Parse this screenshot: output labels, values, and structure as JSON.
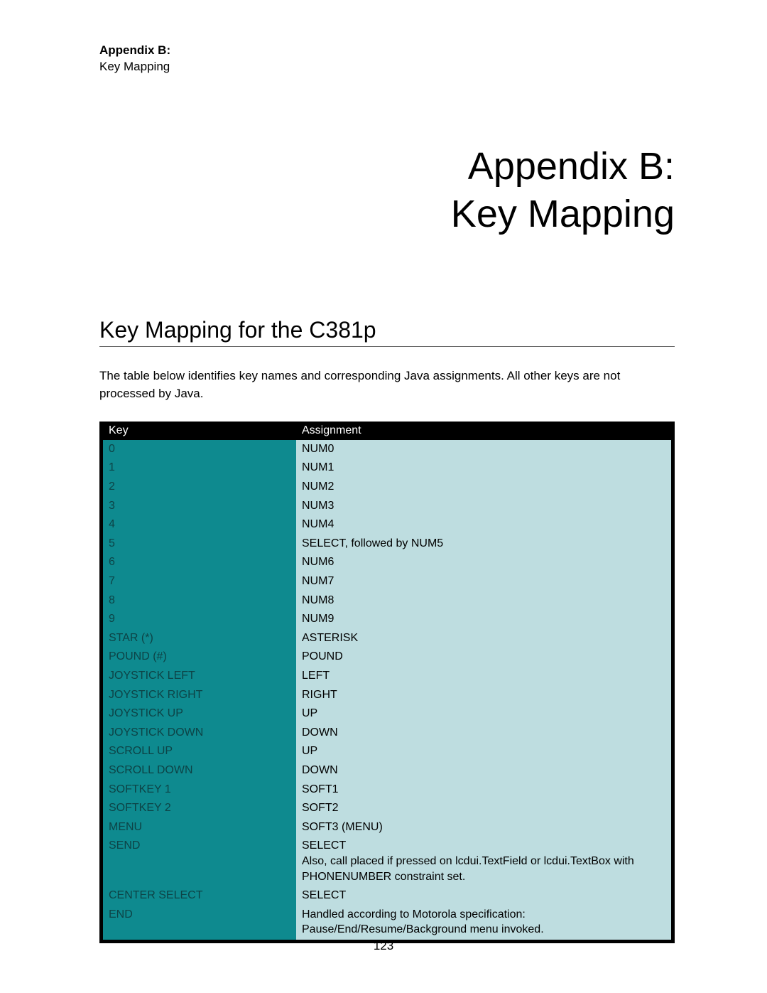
{
  "header": {
    "line1": "Appendix B:",
    "line2": "Key Mapping"
  },
  "title": {
    "line1": "Appendix B:",
    "line2": "Key Mapping"
  },
  "section_title": "Key Mapping for the C381p",
  "intro": "The table below identifies key names and corresponding Java assignments. All other keys are not processed by Java.",
  "table": {
    "headers": {
      "col1": "Key",
      "col2": "Assignment"
    },
    "rows": [
      {
        "key": "0",
        "assignment": "NUM0"
      },
      {
        "key": "1",
        "assignment": "NUM1"
      },
      {
        "key": "2",
        "assignment": "NUM2"
      },
      {
        "key": "3",
        "assignment": "NUM3"
      },
      {
        "key": "4",
        "assignment": "NUM4"
      },
      {
        "key": "5",
        "assignment": "SELECT, followed by NUM5"
      },
      {
        "key": "6",
        "assignment": "NUM6"
      },
      {
        "key": "7",
        "assignment": "NUM7"
      },
      {
        "key": "8",
        "assignment": "NUM8"
      },
      {
        "key": "9",
        "assignment": "NUM9"
      },
      {
        "key": "STAR (*)",
        "assignment": "ASTERISK"
      },
      {
        "key": "POUND (#)",
        "assignment": "POUND"
      },
      {
        "key": "JOYSTICK LEFT",
        "assignment": "LEFT"
      },
      {
        "key": "JOYSTICK RIGHT",
        "assignment": "RIGHT"
      },
      {
        "key": "JOYSTICK UP",
        "assignment": "UP"
      },
      {
        "key": "JOYSTICK DOWN",
        "assignment": "DOWN"
      },
      {
        "key": "SCROLL UP",
        "assignment": "UP"
      },
      {
        "key": "SCROLL DOWN",
        "assignment": "DOWN"
      },
      {
        "key": "SOFTKEY 1",
        "assignment": "SOFT1"
      },
      {
        "key": "SOFTKEY 2",
        "assignment": "SOFT2"
      },
      {
        "key": "MENU",
        "assignment": "SOFT3 (MENU)"
      },
      {
        "key": "SEND",
        "assignment": "SELECT\nAlso, call placed if pressed on lcdui.TextField or lcdui.TextBox with PHONENUMBER constraint set."
      },
      {
        "key": "CENTER SELECT",
        "assignment": "SELECT"
      },
      {
        "key": "END",
        "assignment": "Handled according to Motorola specification:\nPause/End/Resume/Background menu invoked."
      }
    ]
  },
  "page_number": "123"
}
